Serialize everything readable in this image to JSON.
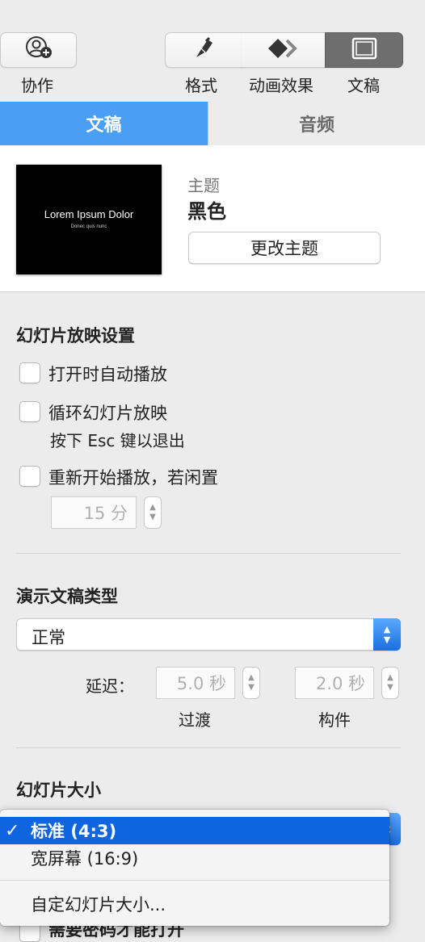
{
  "toolbar": {
    "collaborate_label": "协作",
    "format_label": "格式",
    "animate_label": "动画效果",
    "document_label": "文稿"
  },
  "tabs": [
    {
      "label": "文稿",
      "active": true
    },
    {
      "label": "音频",
      "active": false
    }
  ],
  "theme": {
    "thumbnail_title": "Lorem Ipsum Dolor",
    "thumbnail_subtitle": "Donec quis nunc",
    "caption": "主题",
    "name": "黑色",
    "change_button": "更改主题"
  },
  "slideshow": {
    "title": "幻灯片放映设置",
    "autoplay_label": "打开时自动播放",
    "loop_label": "循环幻灯片放映",
    "esc_hint": "按下 Esc 键以退出",
    "restart_label": "重新开始播放，若闲置",
    "idle_value": "15 分"
  },
  "presentation_type": {
    "title": "演示文稿类型",
    "selected": "正常",
    "delay_label": "延迟：",
    "transition_value": "5.0 秒",
    "build_value": "2.0 秒",
    "transition_caption": "过渡",
    "build_caption": "构件"
  },
  "slide_size": {
    "title": "幻灯片大小",
    "menu": [
      {
        "label": "标准 (4:3)",
        "selected": true
      },
      {
        "label": "宽屏幕 (16:9)",
        "selected": false
      },
      {
        "label": "自定幻灯片大小...",
        "selected": false
      }
    ],
    "checkmark": "✓",
    "obscured_text": "需要密码才能打开"
  },
  "colors": {
    "accent": "#4a9ff5",
    "menu_highlight": "#0f65e0",
    "selected_segment": "#6e6e6e"
  },
  "icons": {
    "collaborate": "add-person-icon",
    "format": "paintbrush-icon",
    "animate": "diamond-icon",
    "document": "document-window-icon",
    "checkmark": "checkmark-icon"
  }
}
